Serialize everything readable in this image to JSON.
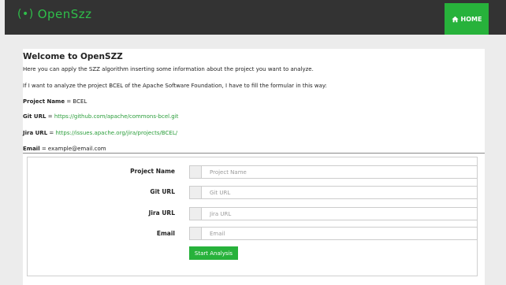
{
  "nav": {
    "brand_icon": "(•)",
    "brand": "OpenSzz",
    "home_label": "HOME",
    "accent": "#27b23b"
  },
  "main": {
    "title": "Welcome to OpenSZZ",
    "intro": "Here you can apply the SZZ algorithm inserting some information about the project you want to analyze.",
    "example_intro": "If I want to analyze the project BCEL of the Apache Software Foundation, I have to fill the formular in this way:",
    "project_label": "Project Name",
    "project_value": "= BCEL",
    "git_label": "Git URL",
    "git_eq": "=",
    "git_value": "https://github.com/apache/commons-bcel.git",
    "jira_label": "Jira URL",
    "jira_eq": "=",
    "jira_value": "https://issues.apache.org/jira/projects/BCEL/",
    "email_label": "Email",
    "email_value": "= example@email.com"
  },
  "form": {
    "project_label": "Project Name",
    "project_placeholder": "Project Name",
    "git_label": "Git URL",
    "git_placeholder": "Git URL",
    "jira_label": "Jira URL",
    "jira_placeholder": "Jira URL",
    "email_label": "Email",
    "email_placeholder": "Email",
    "submit_label": "Start Analysis"
  }
}
